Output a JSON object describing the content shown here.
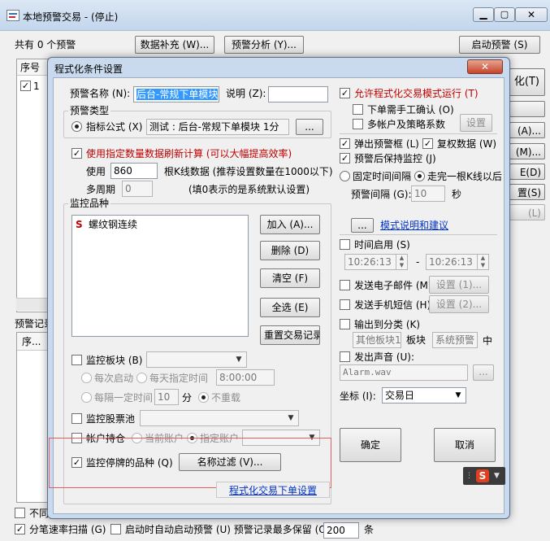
{
  "main_window": {
    "title": "本地预警交易 - (停止)",
    "count_label": "共有 0 个预警",
    "supplement_button": "数据补充 (W)...",
    "analysis_button": "预警分析 (Y)...",
    "start_button": "启动预警 (S)",
    "column_seq": "序号",
    "row1_seq": "1",
    "records_label": "预警记录",
    "records_col_seq": "序...",
    "side_labels": [
      "化(T)",
      "(A)...",
      "(M)...",
      "E(D)",
      "置(S)",
      "(L)"
    ],
    "bottom_not": "不同",
    "bottom_scan": "分笔速率扫描 (G)",
    "bottom_autostart": "启动时自动启动预警 (U) 预警记录最多保留 (O):",
    "bottom_keep_value": "200",
    "bottom_unit": "条"
  },
  "dialog": {
    "title": "程式化条件设置",
    "name_label": "预警名称 (N):",
    "name_value": "后台-常规下单模块",
    "desc_label": "说明 (Z):",
    "desc_value": "",
    "type_group": "预警类型",
    "indicator_label": "指标公式 (X)",
    "indicator_value": "测试 : 后台-常规下单模块 1分",
    "indicator_button": "...",
    "use_specified_label": "使用指定数量数据刷新计算 (可以大幅提高效率)",
    "use_label": "使用",
    "use_value": "860",
    "use_suffix": "根K线数据 (推荐设置数量在1000以下)",
    "periods_label": "多周期",
    "periods_value": "0",
    "periods_suffix": "(填0表示的是系统默认设置)",
    "monitor_group": "监控品种",
    "stock_item_icon": "S",
    "stock_item_name": "螺纹钢连续",
    "add_button": "加入 (A)...",
    "delete_button": "删除 (D)",
    "clear_button": "清空 (F)",
    "select_all_button": "全选 (E)",
    "reset_records_button": "重置交易记录",
    "monitor_sector_label": "监控板块 (B)",
    "each_start_label": "每次启动",
    "daily_time_label": "每天指定时间",
    "daily_time_value": "8:00:00",
    "interval_label": "每隔一定时间",
    "interval_value": "10",
    "interval_unit": "分",
    "no_repeat_label": "不重载",
    "monitor_pool_label": "监控股票池",
    "account_label": "帐户持仓",
    "current_account_label": "当前账户",
    "specified_account_label": "指定账户",
    "monitor_suspended_label": "监控停牌的品种 (Q)",
    "name_filter_button": "名称过滤 (V)...",
    "allow_trade_label": "允许程式化交易模式运行 (T)",
    "manual_confirm_label": "下单需手工确认 (O)",
    "multi_account_label": "多帐户及策略系数",
    "multi_account_button": "设置",
    "popup_label": "弹出预警框 (L)",
    "reuse_data_label": "复权数据 (W)",
    "keep_monitor_label": "预警后保持监控 (J)",
    "fixed_interval_label": "固定时间间隔",
    "after_kline_label": "走完一根K线以后",
    "alert_interval_label": "预警间隔 (G):",
    "alert_interval_value": "10",
    "alert_interval_unit": "秒",
    "help_button": "...",
    "help_link": "模式说明和建议",
    "time_enable_label": "时间启用 (S)",
    "time_start": "10:26:13",
    "time_dash": "-",
    "time_end": "10:26:13",
    "email_label": "发送电子邮件 (M)",
    "email_button": "设置 (1)...",
    "sms_label": "发送手机短信 (H)",
    "sms_button": "设置 (2)...",
    "output_label": "输出到分类 (K)",
    "other_sector": "其他板块1",
    "sector_label": "板块",
    "system_alert": "系统预警",
    "middle_label": "中",
    "sound_label": "发出声音 (U):",
    "sound_value": "Alarm.wav",
    "sound_button": "...",
    "coord_label": "坐标 (I):",
    "coord_value": "交易日",
    "ok_button": "确定",
    "cancel_button": "取消",
    "trade_settings_link": "程式化交易下单设置",
    "ime_label": "S"
  },
  "colors": {
    "red_label": "#c00000",
    "link": "#0033cc",
    "highlight_box": "#e06060",
    "selection": "#3399ff"
  }
}
